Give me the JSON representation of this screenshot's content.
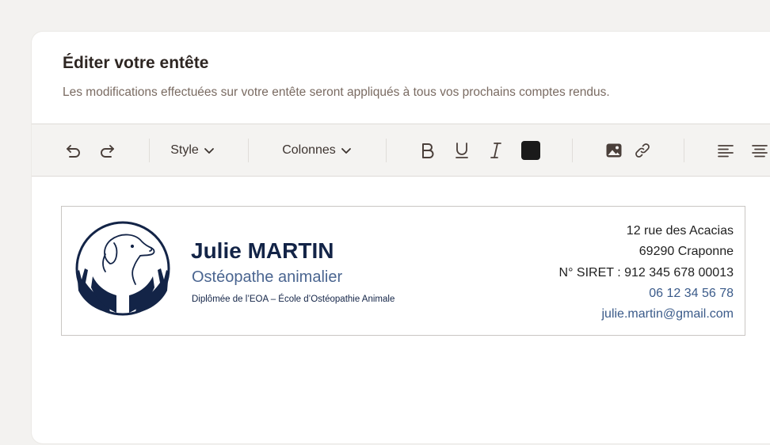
{
  "header": {
    "title": "Éditer votre entête",
    "subtitle": "Les modifications effectuées sur votre entête seront appliqués à tous vos prochains comptes rendus."
  },
  "toolbar": {
    "style_label": "Style",
    "columns_label": "Colonnes",
    "text_color": "#1a1a1a",
    "icons": [
      "undo-icon",
      "redo-icon",
      "chevron-down-icon",
      "bold-icon",
      "underline-icon",
      "italic-icon",
      "image-icon",
      "link-icon",
      "align-left-icon",
      "align-center-icon"
    ]
  },
  "signature": {
    "name": "Julie MARTIN",
    "role": "Ostéopathe animalier",
    "diploma": "Diplômée de l’EOA – École d’Ostéopathie Animale",
    "address_line1": "12 rue des Acacias",
    "address_line2": "69290 Craponne",
    "siret": "N° SIRET : 912 345 678 00013",
    "phone": "06 12 34 56 78",
    "email": "julie.martin@gmail.com",
    "brand_color": "#132447",
    "accent_color": "#4a6590"
  }
}
